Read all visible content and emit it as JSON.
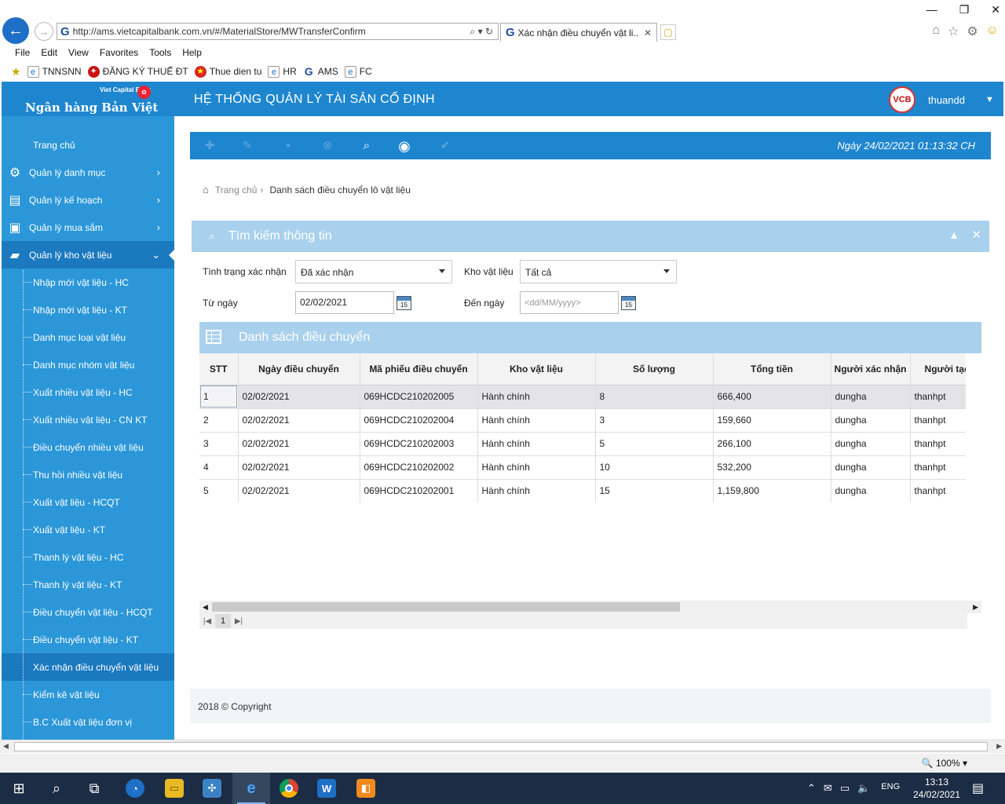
{
  "browser": {
    "url": "http://ams.vietcapitalbank.com.vn/#/MaterialStore/MWTransferConfirm",
    "tab_title": "Xác nhận điều chuyển vật li...",
    "menu": [
      "File",
      "Edit",
      "View",
      "Favorites",
      "Tools",
      "Help"
    ],
    "favorites": [
      {
        "label": "TNNSNN",
        "icon": "ie-page-icon"
      },
      {
        "label": "ĐĂNG KÝ THUẾ ĐT",
        "icon": "tax-logo-icon"
      },
      {
        "label": "Thue dien tu",
        "icon": "tax-emblem-icon"
      },
      {
        "label": "HR",
        "icon": "ie-page-icon"
      },
      {
        "label": "AMS",
        "icon": "g-logo-icon"
      },
      {
        "label": "FC",
        "icon": "ie-page-icon"
      }
    ],
    "zoom": "100%"
  },
  "app": {
    "bank_small": "Viet Capital Bank",
    "bank_name": "Ngân hàng Bản Việt",
    "system_title": "HỆ THỐNG QUẢN LÝ TÀI SẢN CỐ ĐỊNH",
    "user": "thuandd"
  },
  "sidebar": {
    "home": "Trang chủ",
    "sections": [
      {
        "label": "Quản lý danh mục",
        "icon": "gear-icon"
      },
      {
        "label": "Quản lý kế hoạch",
        "icon": "board-icon"
      },
      {
        "label": "Quản lý mua sắm",
        "icon": "purchase-icon"
      },
      {
        "label": "Quản lý kho vật liệu",
        "icon": "bag-icon"
      }
    ],
    "subitems": [
      "Nhập mới vật liệu - HC",
      "Nhập mới vật liệu - KT",
      "Danh mục loại vật liệu",
      "Danh mục nhóm vật liệu",
      "Xuất nhiều vật liệu - HC",
      "Xuất nhiều vật liệu - CN KT",
      "Điều chuyển nhiều vật liệu",
      "Thu hồi nhiều vật liệu",
      "Xuất vật liệu - HCQT",
      "Xuất vật liệu - KT",
      "Thanh lý vật liệu - HC",
      "Thanh lý vật liệu - KT",
      "Điều chuyển vật liệu - HCQT",
      "Điều chuyển vật liệu - KT",
      "Xác nhận điều chuyển vật liệu",
      "Kiểm kê vật liệu",
      "B.C Xuất vật liệu đơn vị"
    ]
  },
  "toolbar": {
    "datetime": "Ngày 24/02/2021   01:13:32 CH"
  },
  "breadcrumb": {
    "home": "Trang chủ",
    "current": "Danh sách điều chuyển lô vật liệu"
  },
  "search": {
    "title": "Tìm kiếm thông tin",
    "status_label": "Tình trạng xác nhận",
    "status_value": "Đã xác nhận",
    "store_label": "Kho vật liệu",
    "store_value": "Tất cả",
    "from_label": "Từ ngày",
    "from_value": "02/02/2021",
    "to_label": "Đến ngày",
    "to_placeholder": "<dd/MM/yyyy>",
    "cal_label": "15"
  },
  "list": {
    "title": "Danh sách điều chuyển",
    "columns": [
      "STT",
      "Ngày điều chuyển",
      "Mã phiếu điều chuyển",
      "Kho vật liệu",
      "Số lượng",
      "Tổng tiền",
      "Người xác nhận",
      "Người tạo"
    ],
    "rows": [
      [
        "1",
        "02/02/2021",
        "069HCDC210202005",
        "Hành chính",
        "8",
        "666,400",
        "dungha",
        "thanhpt"
      ],
      [
        "2",
        "02/02/2021",
        "069HCDC210202004",
        "Hành chính",
        "3",
        "159,660",
        "dungha",
        "thanhpt"
      ],
      [
        "3",
        "02/02/2021",
        "069HCDC210202003",
        "Hành chính",
        "5",
        "266,100",
        "dungha",
        "thanhpt"
      ],
      [
        "4",
        "02/02/2021",
        "069HCDC210202002",
        "Hành chính",
        "10",
        "532,200",
        "dungha",
        "thanhpt"
      ],
      [
        "5",
        "02/02/2021",
        "069HCDC210202001",
        "Hành chính",
        "15",
        "1,159,800",
        "dungha",
        "thanhpt"
      ]
    ],
    "page": "1"
  },
  "footer": "2018 © Copyright",
  "taskbar": {
    "lang": "ENG",
    "time": "13:13",
    "date": "24/02/2021"
  },
  "colors": {
    "primary": "#1e86cf",
    "sidebar": "#2b97d8",
    "panel": "#a9d1ee"
  }
}
